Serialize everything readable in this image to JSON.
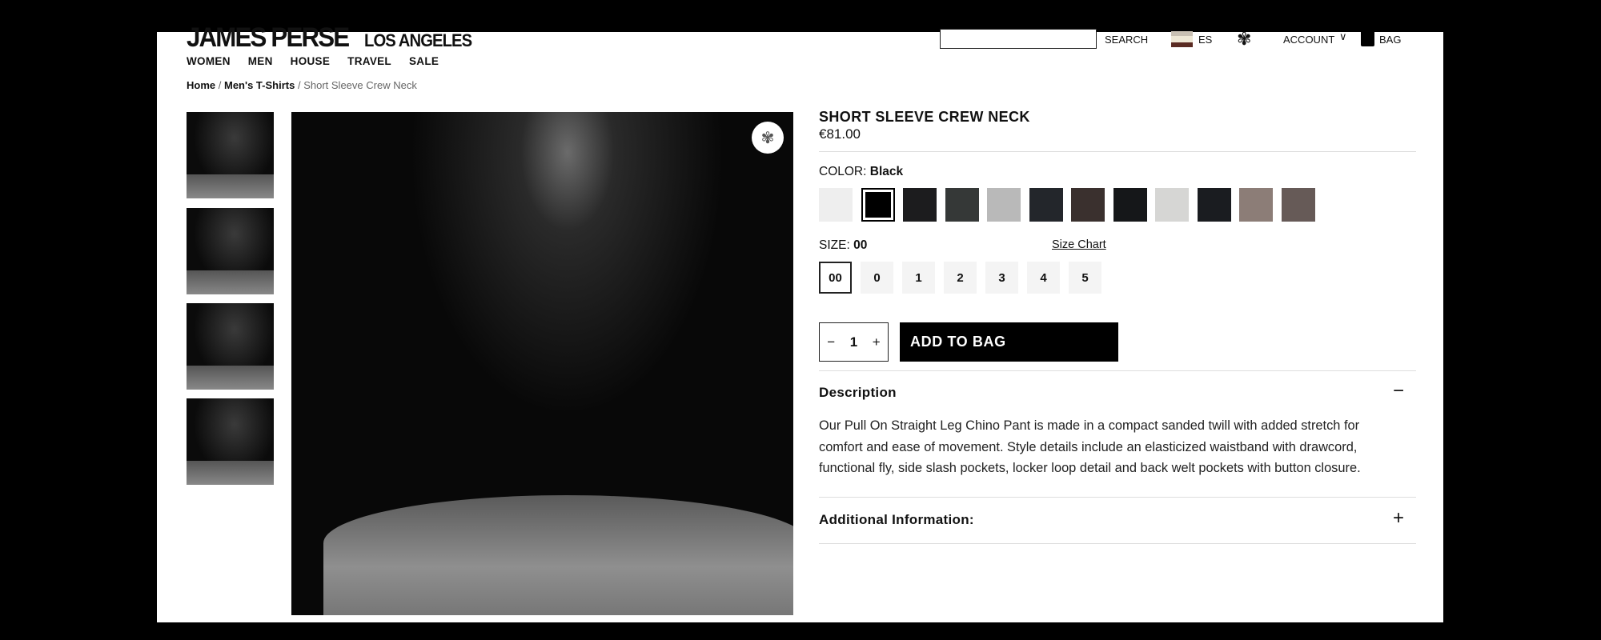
{
  "header": {
    "brand": "JAMES PERSE",
    "brand_sub": "LOS ANGELES",
    "search_placeholder": "",
    "search_label": "SEARCH",
    "region": "ES",
    "account": "ACCOUNT",
    "bag": "BAG"
  },
  "nav": [
    "WOMEN",
    "MEN",
    "HOUSE",
    "TRAVEL",
    "SALE"
  ],
  "breadcrumb": {
    "home": "Home",
    "category": "Men's T-Shirts",
    "current": "Short Sleeve Crew Neck",
    "sep": "/"
  },
  "product": {
    "title": "SHORT SLEEVE CREW NECK",
    "price": "€81.00",
    "color_label": "COLOR:",
    "color_value": "Black",
    "swatches": [
      "#eeeeee",
      "#000000",
      "#1c1c1e",
      "#353837",
      "#b9b9b9",
      "#23262b",
      "#3a302e",
      "#151719",
      "#d6d6d4",
      "#1a1c20",
      "#8c7d77",
      "#665a57"
    ],
    "selected_swatch": 1,
    "size_label": "SIZE:",
    "size_value": "00",
    "size_chart": "Size Chart",
    "sizes": [
      "00",
      "0",
      "1",
      "2",
      "3",
      "4",
      "5"
    ],
    "quantity": "1",
    "add_to_bag": "ADD TO BAG",
    "description_title": "Description",
    "description": "Our Pull On Straight Leg Chino Pant is made in a compact sanded twill with added stretch for comfort and ease of movement. Style details include an elasticized waistband with drawcord, functional fly, side slash pockets, locker loop detail and back welt pockets with button closure.",
    "additional_title": "Additional Information:"
  }
}
